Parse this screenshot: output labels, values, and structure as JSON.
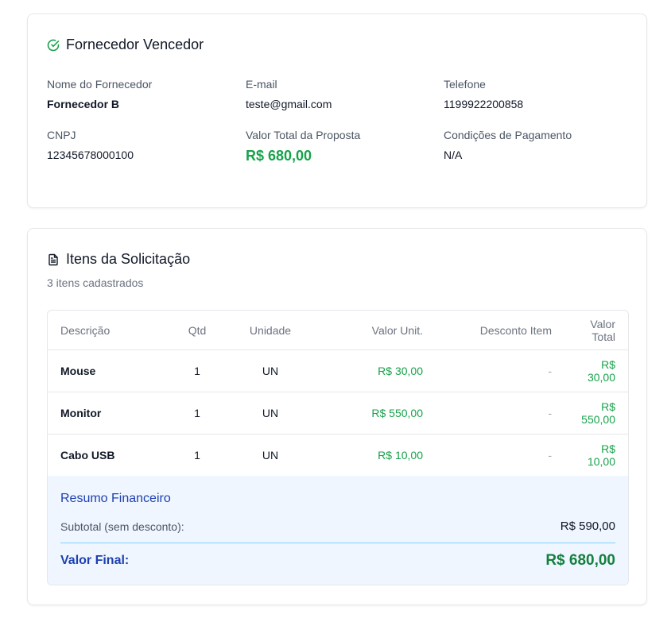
{
  "winner": {
    "title": "Fornecedor Vencedor",
    "icon": "check-circle-icon",
    "name_label": "Nome do Fornecedor",
    "name_value": "Fornecedor B",
    "email_label": "E-mail",
    "email_value": "teste@gmail.com",
    "phone_label": "Telefone",
    "phone_value": "1199922200858",
    "cnpj_label": "CNPJ",
    "cnpj_value": "12345678000100",
    "total_label": "Valor Total da Proposta",
    "total_value": "R$ 680,00",
    "payment_label": "Condições de Pagamento",
    "payment_value": "N/A"
  },
  "items": {
    "title": "Itens da Solicitação",
    "icon": "document-icon",
    "count_text": "3 itens cadastrados",
    "columns": [
      "Descrição",
      "Qtd",
      "Unidade",
      "Valor Unit.",
      "Desconto Item",
      "Valor Total"
    ],
    "rows": [
      {
        "desc": "Mouse",
        "qtd": "1",
        "unit": "UN",
        "unit_value": "R$ 30,00",
        "discount": "-",
        "total": "R$ 30,00"
      },
      {
        "desc": "Monitor",
        "qtd": "1",
        "unit": "UN",
        "unit_value": "R$ 550,00",
        "discount": "-",
        "total": "R$ 550,00"
      },
      {
        "desc": "Cabo USB",
        "qtd": "1",
        "unit": "UN",
        "unit_value": "R$ 10,00",
        "discount": "-",
        "total": "R$ 10,00"
      }
    ]
  },
  "summary": {
    "title": "Resumo Financeiro",
    "subtotal_label": "Subtotal (sem desconto):",
    "subtotal_value": "R$ 590,00",
    "final_label": "Valor Final:",
    "final_value": "R$ 680,00"
  },
  "colors": {
    "accent_green": "#16a34a",
    "summary_blue": "#1e40af",
    "summary_bg": "#eff6ff"
  }
}
